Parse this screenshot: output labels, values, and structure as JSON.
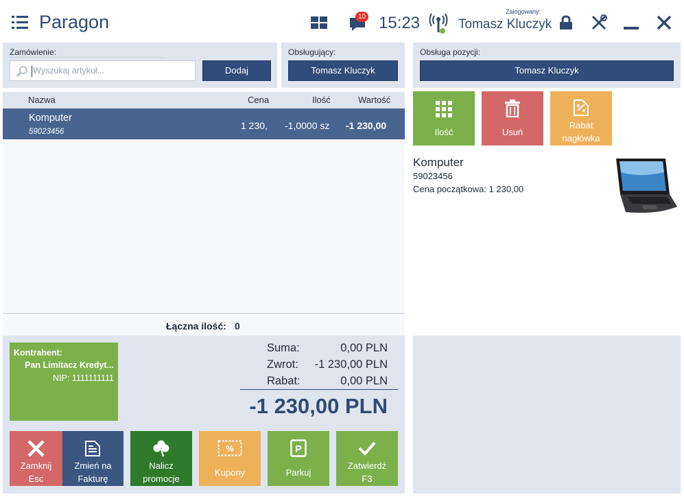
{
  "header": {
    "title": "Paragon",
    "notifications_count": "10",
    "time": "15:23",
    "logged_label": "Zalogowany:",
    "logged_user": "Tomasz Kluczyk"
  },
  "order": {
    "label": "Zamówienie:",
    "search_placeholder": "Wyszukaj artykuł...",
    "add_button": "Dodaj"
  },
  "cashier": {
    "label": "Obsługujący:",
    "name": "Tomasz Kluczyk"
  },
  "position_service": {
    "label": "Obsługa pozycji:",
    "name": "Tomasz Kluczyk"
  },
  "table": {
    "columns": [
      "Nazwa",
      "Cena",
      "Ilość",
      "Wartość"
    ],
    "rows": [
      {
        "name": "Komputer",
        "code": "59023456",
        "price": "1 230,",
        "qty": "-1,0000 sz",
        "value": "-1 230,00"
      }
    ],
    "total_label": "Łączna ilość:",
    "total_value": "0"
  },
  "contractor": {
    "label": "Kontrahent:",
    "name": "Pan Limitacz Kredyt...",
    "nip": "NIP: 1111111111"
  },
  "summary": {
    "sum_label": "Suma:",
    "sum_value": "0,00 PLN",
    "change_label": "Zwrot:",
    "change_value": "-1 230,00 PLN",
    "discount_label": "Rabat:",
    "discount_value": "0,00 PLN",
    "total": "-1 230,00 PLN"
  },
  "actions": {
    "close": [
      "Zamknij",
      "Esc"
    ],
    "invoice": [
      "Zmień na",
      "Fakturę"
    ],
    "promo": [
      "Nalicz",
      "promocje"
    ],
    "coupons": "Kupony",
    "park": "Parkuj",
    "confirm": [
      "Zatwierdź",
      "F3"
    ]
  },
  "item_actions": {
    "qty": "Ilość",
    "remove": "Usuń",
    "discount": [
      "Rabat",
      "nagłówka"
    ]
  },
  "item_detail": {
    "name": "Komputer",
    "code": "59023456",
    "initial_price": "Cena początkowa: 1 230,00"
  },
  "colors": {
    "navy": "#2f4c7a",
    "green": "#7bb04b",
    "dark_green": "#2e7a2a",
    "red": "#d46767",
    "orange": "#efb05a",
    "panel": "#dfe5ee"
  },
  "icons": [
    "menu-icon",
    "tiles-icon",
    "chat-icon",
    "antenna-icon",
    "lock-icon",
    "tools-icon",
    "minimize-icon",
    "close-icon",
    "search-icon",
    "grid-icon",
    "trash-icon",
    "discount-icon",
    "x-icon",
    "document-icon",
    "clover-icon",
    "coupon-icon",
    "parking-icon",
    "check-icon",
    "laptop-icon"
  ]
}
